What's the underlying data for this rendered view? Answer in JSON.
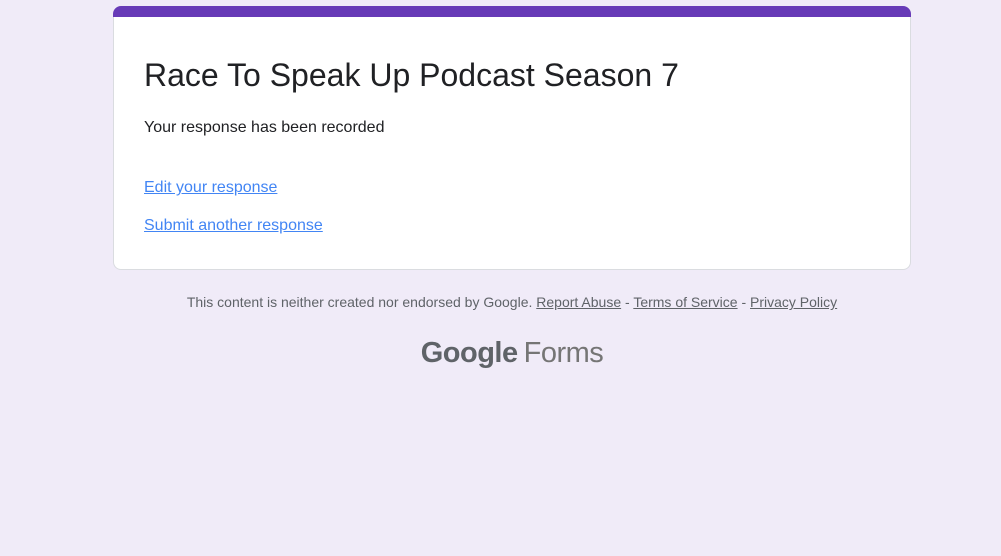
{
  "theme": {
    "accent_color": "#673ab7",
    "background_color": "#f0ebf8",
    "link_color": "#4285f4",
    "card_border_color": "#dadce0"
  },
  "card": {
    "title": "Race To Speak Up Podcast Season 7",
    "confirmation_message": "Your response has been recorded",
    "links": [
      {
        "label": "Edit your response"
      },
      {
        "label": "Submit another response"
      }
    ]
  },
  "footer": {
    "disclaimer": "This content is neither created nor endorsed by Google.",
    "links": [
      {
        "label": "Report Abuse"
      },
      {
        "label": "Terms of Service"
      },
      {
        "label": "Privacy Policy"
      }
    ],
    "separator": "-"
  },
  "logo": {
    "brand": "Google",
    "product": "Forms"
  }
}
